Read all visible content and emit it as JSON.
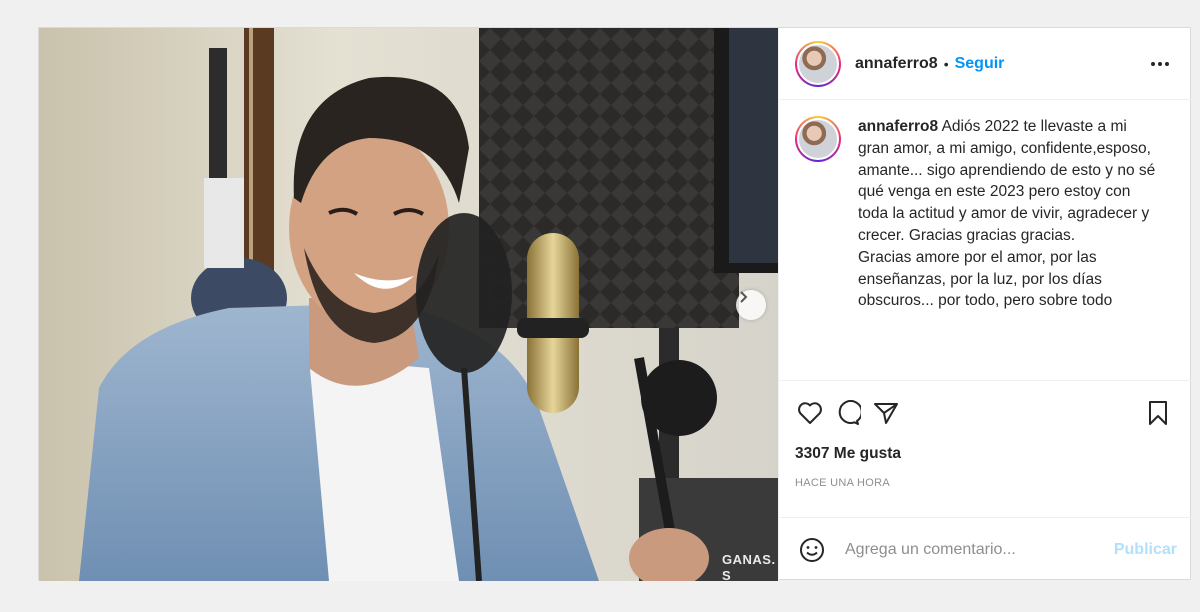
{
  "header": {
    "username": "annaferro8",
    "separator": "•",
    "follow_label": "Seguir",
    "more_icon": "more-horizontal-icon"
  },
  "caption": {
    "username": "annaferro8",
    "text": "Adiós 2022 te llevaste a mi gran amor, a mi amigo, confidente,esposo, amante... sigo aprendiendo de esto y no sé qué venga en este 2023 pero estoy con toda la actitud y amor de vivir, agradecer y crecer. Gracias gracias gracias.\nGracias amore por el amor, por las enseñanzas, por la luz, por los días obscuros... por todo, pero sobre todo"
  },
  "photo": {
    "overlay_text": "GANAS. S\nTROBE"
  },
  "actions": {
    "icons": [
      "heart-icon",
      "comment-icon",
      "share-icon",
      "bookmark-icon"
    ],
    "likes_count": "3307",
    "likes_label": "Me gusta",
    "timestamp": "HACE UNA HORA"
  },
  "comment_box": {
    "placeholder": "Agrega un comentario...",
    "publish_label": "Publicar"
  },
  "colors": {
    "accent": "#0095f6",
    "publish_disabled": "#b2dffc",
    "muted": "#8e8e8e"
  }
}
